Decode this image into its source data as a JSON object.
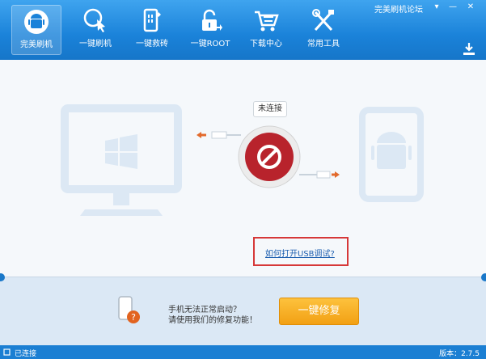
{
  "titlebar": {
    "forum_link": "完美刷机论坛"
  },
  "nav": [
    {
      "label": "完美刷机"
    },
    {
      "label": "一键刷机"
    },
    {
      "label": "一键救砖"
    },
    {
      "label": "一键ROOT"
    },
    {
      "label": "下载中心"
    },
    {
      "label": "常用工具"
    }
  ],
  "main": {
    "connection_status": "未连接",
    "help_link": "如何打开USB调试?"
  },
  "bottom": {
    "message_line1": "手机无法正常启动？",
    "message_line2": "请使用我们的修复功能！",
    "repair_button": "一键修复"
  },
  "statusbar": {
    "connection": "已连接",
    "version": "版本：2.7.5"
  },
  "colors": {
    "brand_blue": "#1a82d9",
    "accent_orange": "#f5a623",
    "alert_red": "#d63838"
  }
}
